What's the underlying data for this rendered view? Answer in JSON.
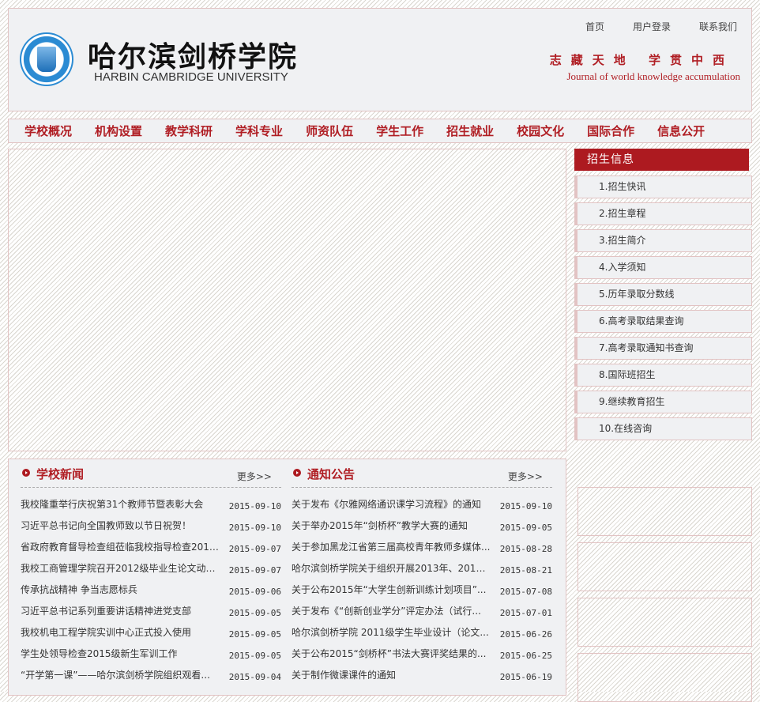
{
  "header": {
    "school_cn": "哈尔滨剑桥学院",
    "school_en": "HARBIN CAMBRIDGE UNIVERSITY",
    "links": [
      "首页",
      "用户登录",
      "联系我们"
    ],
    "motto_cn": "志藏天地 学贯中西",
    "motto_en": "Journal of world knowledge accumulation"
  },
  "nav": [
    "学校概况",
    "机构设置",
    "教学科研",
    "学科专业",
    "师资队伍",
    "学生工作",
    "招生就业",
    "校园文化",
    "国际合作",
    "信息公开"
  ],
  "sidebar": {
    "title": "招生信息",
    "items": [
      "1.招生快讯",
      "2.招生章程",
      "3.招生简介",
      "4.入学须知",
      "5.历年录取分数线",
      "6.高考录取结果查询",
      "7.高考录取通知书查询",
      "8.国际班招生",
      "9.继续教育招生",
      "10.在线咨询"
    ]
  },
  "news": {
    "title": "学校新闻",
    "more": "更多>>",
    "items": [
      {
        "text": "我校隆重举行庆祝第31个教师节暨表彰大会",
        "date": "2015-09-10"
      },
      {
        "text": "习近平总书记向全国教师致以节日祝贺！",
        "date": "2015-09-10"
      },
      {
        "text": "省政府教育督导检查组莅临我校指导检查2015...",
        "date": "2015-09-07"
      },
      {
        "text": "我校工商管理学院召开2012级毕业生论文动员...",
        "date": "2015-09-07"
      },
      {
        "text": "传承抗战精神 争当志愿标兵",
        "date": "2015-09-06"
      },
      {
        "text": "习近平总书记系列重要讲话精神进党支部",
        "date": "2015-09-05"
      },
      {
        "text": "我校机电工程学院实训中心正式投入使用",
        "date": "2015-09-05"
      },
      {
        "text": "学生处领导检查2015级新生军训工作",
        "date": "2015-09-05"
      },
      {
        "text": "“开学第一课”——哈尔滨剑桥学院组织观看...",
        "date": "2015-09-04"
      }
    ]
  },
  "notices": {
    "title": "通知公告",
    "more": "更多>>",
    "items": [
      {
        "text": "关于发布《尔雅网络通识课学习流程》的通知",
        "date": "2015-09-10"
      },
      {
        "text": "关于举办2015年“剑桥杯”教学大赛的通知",
        "date": "2015-09-05"
      },
      {
        "text": "关于参加黑龙江省第三届高校青年教师多媒体...",
        "date": "2015-08-28"
      },
      {
        "text": "哈尔滨剑桥学院关于组织开展2013年、2014年...",
        "date": "2015-08-21"
      },
      {
        "text": "关于公布2015年“大学生创新训练计划项目”...",
        "date": "2015-07-08"
      },
      {
        "text": "关于发布《“创新创业学分”评定办法（试行...",
        "date": "2015-07-01"
      },
      {
        "text": "哈尔滨剑桥学院 2011级学生毕业设计（论文...",
        "date": "2015-06-26"
      },
      {
        "text": "关于公布2015“剑桥杯”书法大赛评奖结果的...",
        "date": "2015-06-25"
      },
      {
        "text": "关于制作微课课件的通知",
        "date": "2015-06-19"
      }
    ]
  }
}
